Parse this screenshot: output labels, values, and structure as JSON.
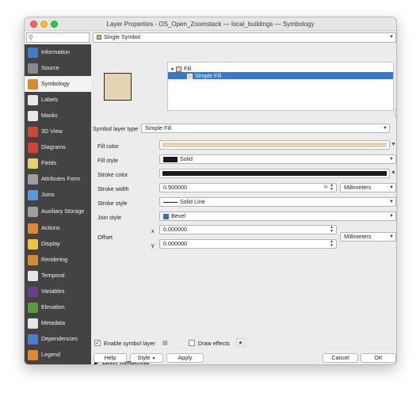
{
  "window": {
    "title": "Layer Properties - OS_Open_Zoomstack — local_buildings — Symbology"
  },
  "sidebar": {
    "search_placeholder": "",
    "items": [
      {
        "label": "Information",
        "icon": "information-icon",
        "color": "#3b7fcb"
      },
      {
        "label": "Source",
        "icon": "source-icon",
        "color": "#8a8a8a"
      },
      {
        "label": "Symbology",
        "icon": "symbology-icon",
        "color": "#d98b2b"
      },
      {
        "label": "Labels",
        "icon": "labels-icon",
        "color": "#e8e8e8"
      },
      {
        "label": "Masks",
        "icon": "masks-icon",
        "color": "#e8e8e8"
      },
      {
        "label": "3D View",
        "icon": "3d-view-icon",
        "color": "#cc4a2f"
      },
      {
        "label": "Diagrams",
        "icon": "diagrams-icon",
        "color": "#d6442f"
      },
      {
        "label": "Fields",
        "icon": "fields-icon",
        "color": "#e8d072"
      },
      {
        "label": "Attributes Form",
        "icon": "attributes-form-icon",
        "color": "#9e9e9e"
      },
      {
        "label": "Joins",
        "icon": "joins-icon",
        "color": "#5a9ad8"
      },
      {
        "label": "Auxiliary Storage",
        "icon": "auxiliary-storage-icon",
        "color": "#9e9e9e"
      },
      {
        "label": "Actions",
        "icon": "actions-icon",
        "color": "#e08a2e"
      },
      {
        "label": "Display",
        "icon": "display-icon",
        "color": "#f0c43a"
      },
      {
        "label": "Rendering",
        "icon": "rendering-icon",
        "color": "#d68b2b"
      },
      {
        "label": "Temporal",
        "icon": "temporal-icon",
        "color": "#e6e6e6"
      },
      {
        "label": "Variables",
        "icon": "variables-icon",
        "color": "#6a3f8e"
      },
      {
        "label": "Elevation",
        "icon": "elevation-icon",
        "color": "#5a9a3a"
      },
      {
        "label": "Metadata",
        "icon": "metadata-icon",
        "color": "#e6e6e6"
      },
      {
        "label": "Dependencies",
        "icon": "dependencies-icon",
        "color": "#4a7ed0"
      },
      {
        "label": "Legend",
        "icon": "legend-icon",
        "color": "#e08a2e"
      }
    ]
  },
  "renderer": {
    "value": "Single Symbol"
  },
  "symbol_tree": {
    "parent": "Fill",
    "child": "Simple Fill"
  },
  "symbol_layer_type": {
    "label": "Symbol layer type",
    "value": "Simple Fill"
  },
  "fill_color": {
    "label": "Fill color",
    "color": "#e6d4b0"
  },
  "fill_style": {
    "label": "Fill style",
    "value": "Solid"
  },
  "stroke_color": {
    "label": "Stroke color",
    "color": "#1a1a1a"
  },
  "stroke_width": {
    "label": "Stroke width",
    "value": "0.500000",
    "unit": "Millimeters"
  },
  "stroke_style": {
    "label": "Stroke style",
    "value": "Solid Line"
  },
  "join_style": {
    "label": "Join style",
    "value": "Bevel"
  },
  "offset": {
    "label": "Offset",
    "x_label": "x",
    "x": "0.000000",
    "y_label": "y",
    "y": "0.000000",
    "unit": "Millimeters"
  },
  "enable_symbol_layer": {
    "label": "Enable symbol layer",
    "checked": true
  },
  "draw_effects": {
    "label": "Draw effects",
    "checked": false
  },
  "layer_rendering": {
    "label": "Layer Rendering"
  },
  "footer": {
    "help": "Help",
    "style": "Style",
    "apply": "Apply",
    "cancel": "Cancel",
    "ok": "OK"
  }
}
